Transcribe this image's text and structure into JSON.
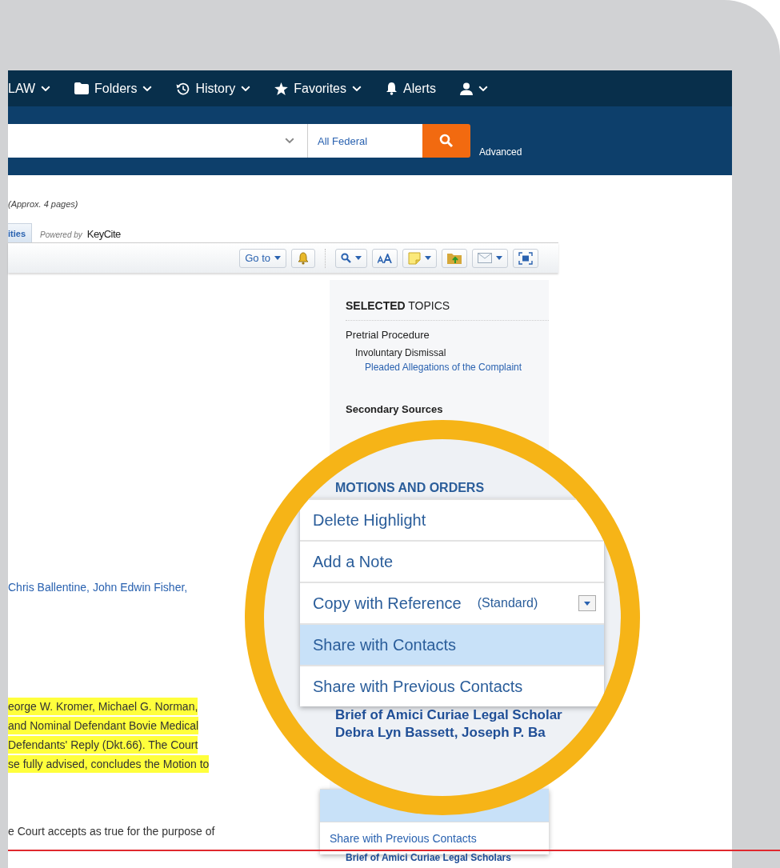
{
  "nav": {
    "items": [
      "LAW",
      "Folders",
      "History",
      "Favorites",
      "Alerts"
    ]
  },
  "search": {
    "jurisdiction": "All Federal",
    "advanced": "Advanced"
  },
  "document": {
    "page_count": "(Approx. 4 pages)",
    "tabs": [
      {
        "label": "ities",
        "selected": true
      }
    ],
    "powered_by": "Powered by",
    "keycite": "KeyCite",
    "go_to": "Go to"
  },
  "body": {
    "groups": [
      {
        "lines": [
          {
            "links": [
              "Chris Ballentine,",
              "John Edwin Fisher,"
            ]
          }
        ]
      },
      {
        "lines": [
          {
            "text": "eorge W. Kromer, Michael G. Norman,",
            "highlighted": true
          },
          {
            "text": "and Nominal Defendant Bovie Medical",
            "highlighted": true
          },
          {
            "text": "Defendants' Reply (Dkt.66). The Court",
            "highlighted": true
          },
          {
            "text": "se fully advised, concludes the Motion to",
            "highlighted": true
          }
        ]
      },
      {
        "lines": [
          {
            "text": "e Court accepts as true for the purpose of",
            "highlighted": false
          }
        ]
      }
    ]
  },
  "sidebar": {
    "heading": "**SELECTED** TOPICS",
    "topics": [
      {
        "label": "Pretrial Procedure",
        "children": [
          {
            "label": "Involuntary Dismissal",
            "children": [
              {
                "label": "Pleaded Allegations of the Complaint"
              }
            ]
          }
        ]
      }
    ],
    "secondary_heading": "Secondary Sources",
    "context_menu": [
      {
        "selected": true
      },
      {
        "label": "Share with Previous Contacts",
        "selected": false
      }
    ],
    "result": "Brief of Amici Curiae Legal Scholars"
  },
  "magnifier": {
    "heading": "MOTIONS AND ORDERS",
    "menu": [
      {
        "label": "Delete Highlight",
        "selected": false
      },
      {
        "label": "Add a Note",
        "selected": false
      },
      {
        "label": "Copy with Reference",
        "option": "(Standard)",
        "selected": false
      },
      {
        "label": "Share with Contacts",
        "selected": true
      },
      {
        "label": "Share with Previous Contacts",
        "selected": false
      }
    ],
    "results": [
      "Brief of Amici Curiae Legal Scholar",
      "Debra Lyn Bassett, Joseph P. Ba"
    ]
  }
}
